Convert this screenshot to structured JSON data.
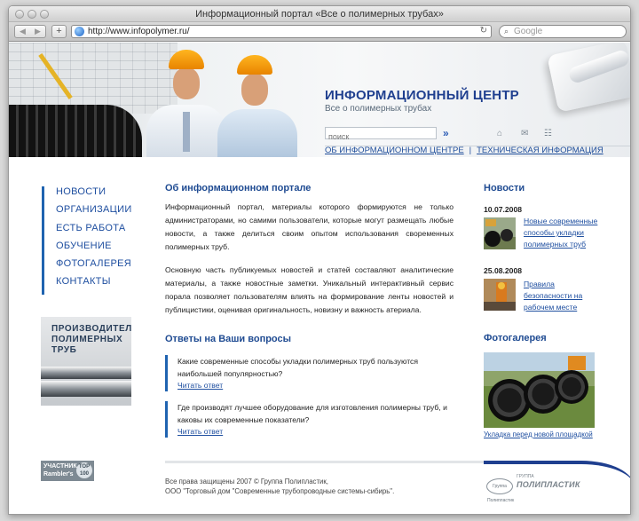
{
  "window": {
    "title": "Информационный портал «Все о полимерных трубах»",
    "url": "http://www.infopolymer.ru/",
    "search_placeholder": "Google"
  },
  "header": {
    "title": "ИНФОРМАЦИОННЫЙ ЦЕНТР",
    "subtitle": "Все о полимерных трубах",
    "search_placeholder": "поиск",
    "nav": [
      {
        "label": "ОБ ИНФОРМАЦИОННОМ ЦЕНТРЕ"
      },
      {
        "label": "ТЕХНИЧЕСКАЯ ИНФОРМАЦИЯ"
      }
    ],
    "separator": "|"
  },
  "sidebar": {
    "items": [
      {
        "label": "НОВОСТИ"
      },
      {
        "label": "ОРГАНИЗАЦИИ"
      },
      {
        "label": "ЕСТЬ РАБОТА"
      },
      {
        "label": "ОБУЧЕНИЕ"
      },
      {
        "label": "ФОТОГАЛЕРЕЯ"
      },
      {
        "label": "КОНТАКТЫ"
      }
    ],
    "banner": {
      "line1": "ПРОИЗВОДИТЕЛЬ",
      "line2": "ПОЛИМЕРНЫХ",
      "line3": "ТРУБ"
    },
    "counter": {
      "line1": "УЧАСТНИК",
      "line2": "Rambler's",
      "top": "TOP 100"
    }
  },
  "main": {
    "about_title": "Об информационном портале",
    "paragraphs": [
      "Информационный портал, материалы которого формируются не только администраторами, но самими пользователи, которые могут размещать любые новости, а также делиться своим опытом использования своременных полимерных труб.",
      "Основную часть публикуемых новостей и статей составляют аналитические материалы, а также новостные заметки. Уникальный интерактивный сервис порала позволяет пользователям влиять на формирование ленты новостей и публицистики, оценивая оригинальность, новизну и важность атериала."
    ],
    "faq_title": "Ответы на Ваши вопросы",
    "faq": [
      {
        "question": "Какие современные способы укладки полимерных труб пользуются наибольшей популярностью?",
        "answer_link": "Читать ответ"
      },
      {
        "question": "Где производят лучшее оборудование для изготовления полимерны труб, и каковы их современные показатели?",
        "answer_link": "Читать ответ"
      }
    ]
  },
  "right": {
    "news_title": "Новости",
    "news": [
      {
        "date": "10.07.2008",
        "title": "Новые современные способы укладки полимерных труб"
      },
      {
        "date": "25.08.2008",
        "title": "Правила безопасности на рабочем месте"
      }
    ],
    "gallery_title": "Фотогалерея",
    "gallery_caption": "Укладка перед новой площадкой"
  },
  "footer": {
    "line1": "Все права защищены 2007 © Группа Полипластик,",
    "line2": "ООО \"Торговый дом \"Современные трубопроводные системы-сибирь\".",
    "logo_small": "ГРУППА",
    "logo_text": "ПОЛИПЛАСТИК",
    "logo_badge": "Группа Полипластик"
  },
  "colors": {
    "brand": "#1f4b92",
    "accent": "#1f63b0",
    "link": "#1f4fa0"
  }
}
